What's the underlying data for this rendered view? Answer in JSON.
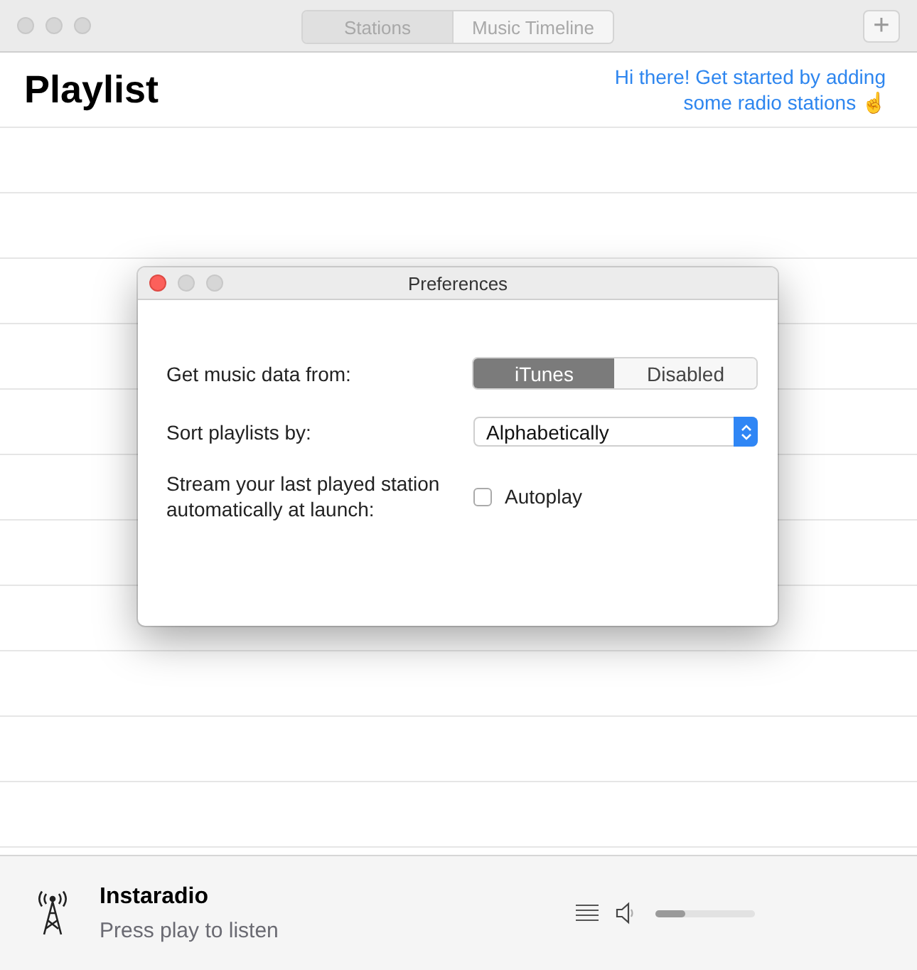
{
  "window": {
    "tabs": [
      {
        "label": "Stations",
        "selected": true
      },
      {
        "label": "Music Timeline",
        "selected": false
      }
    ],
    "add_button": "+"
  },
  "header": {
    "title": "Playlist",
    "hint": "Hi there! Get started by adding some radio stations ☝"
  },
  "preferences": {
    "title": "Preferences",
    "music_source": {
      "label": "Get music data from:",
      "options": [
        {
          "label": "iTunes",
          "selected": true
        },
        {
          "label": "Disabled",
          "selected": false
        }
      ]
    },
    "sort": {
      "label": "Sort playlists by:",
      "value": "Alphabetically"
    },
    "autoplay": {
      "label": "Stream your last played station automatically at launch:",
      "checkbox_label": "Autoplay",
      "checked": false
    }
  },
  "player": {
    "title": "Instaradio",
    "status": "Press play to listen",
    "volume": {
      "level": 0.3
    }
  }
}
